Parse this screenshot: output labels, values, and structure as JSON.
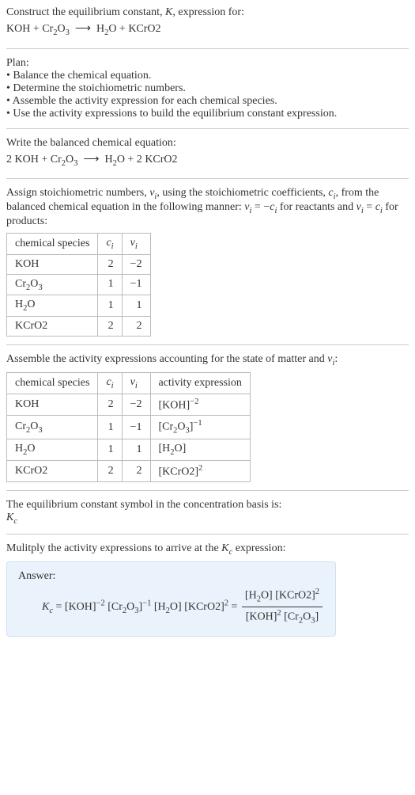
{
  "prompt": {
    "line1": "Construct the equilibrium constant, K, expression for:",
    "reaction_unbalanced": "KOH + Cr₂O₃  ⟶  H₂O + KCrO2"
  },
  "plan": {
    "heading": "Plan:",
    "items": [
      "Balance the chemical equation.",
      "Determine the stoichiometric numbers.",
      "Assemble the activity expression for each chemical species.",
      "Use the activity expressions to build the equilibrium constant expression."
    ]
  },
  "balanced": {
    "heading": "Write the balanced chemical equation:",
    "reaction": "2 KOH + Cr₂O₃  ⟶  H₂O + 2 KCrO2"
  },
  "stoich": {
    "text_a": "Assign stoichiometric numbers, νᵢ, using the stoichiometric coefficients, cᵢ, from the balanced chemical equation in the following manner: νᵢ = −cᵢ for reactants and νᵢ = cᵢ for products:",
    "table": {
      "headers": [
        "chemical species",
        "cᵢ",
        "νᵢ"
      ],
      "rows": [
        {
          "species": "KOH",
          "c": "2",
          "v": "−2"
        },
        {
          "species": "Cr₂O₃",
          "c": "1",
          "v": "−1"
        },
        {
          "species": "H₂O",
          "c": "1",
          "v": "1"
        },
        {
          "species": "KCrO2",
          "c": "2",
          "v": "2"
        }
      ]
    }
  },
  "activity": {
    "text": "Assemble the activity expressions accounting for the state of matter and νᵢ:",
    "table": {
      "headers": [
        "chemical species",
        "cᵢ",
        "νᵢ",
        "activity expression"
      ],
      "rows": [
        {
          "species": "KOH",
          "c": "2",
          "v": "−2",
          "expr": "[KOH]⁻²"
        },
        {
          "species": "Cr₂O₃",
          "c": "1",
          "v": "−1",
          "expr": "[Cr₂O₃]⁻¹"
        },
        {
          "species": "H₂O",
          "c": "1",
          "v": "1",
          "expr": "[H₂O]"
        },
        {
          "species": "KCrO2",
          "c": "2",
          "v": "2",
          "expr": "[KCrO2]²"
        }
      ]
    }
  },
  "symbol": {
    "text": "The equilibrium constant symbol in the concentration basis is:",
    "value": "K_c"
  },
  "multiply": {
    "text": "Mulitply the activity expressions to arrive at the K_c expression:"
  },
  "answer": {
    "label": "Answer:",
    "lhs": "K_c = [KOH]⁻² [Cr₂O₃]⁻¹ [H₂O] [KCrO2]² = ",
    "frac_num": "[H₂O] [KCrO2]²",
    "frac_den": "[KOH]² [Cr₂O₃]"
  },
  "chart_data": {
    "type": "table",
    "tables": [
      {
        "title": "Stoichiometric numbers",
        "columns": [
          "chemical species",
          "c_i",
          "v_i"
        ],
        "rows": [
          [
            "KOH",
            2,
            -2
          ],
          [
            "Cr2O3",
            1,
            -1
          ],
          [
            "H2O",
            1,
            1
          ],
          [
            "KCrO2",
            2,
            2
          ]
        ]
      },
      {
        "title": "Activity expressions",
        "columns": [
          "chemical species",
          "c_i",
          "v_i",
          "activity expression"
        ],
        "rows": [
          [
            "KOH",
            2,
            -2,
            "[KOH]^-2"
          ],
          [
            "Cr2O3",
            1,
            -1,
            "[Cr2O3]^-1"
          ],
          [
            "H2O",
            1,
            1,
            "[H2O]"
          ],
          [
            "KCrO2",
            2,
            2,
            "[KCrO2]^2"
          ]
        ]
      }
    ]
  }
}
